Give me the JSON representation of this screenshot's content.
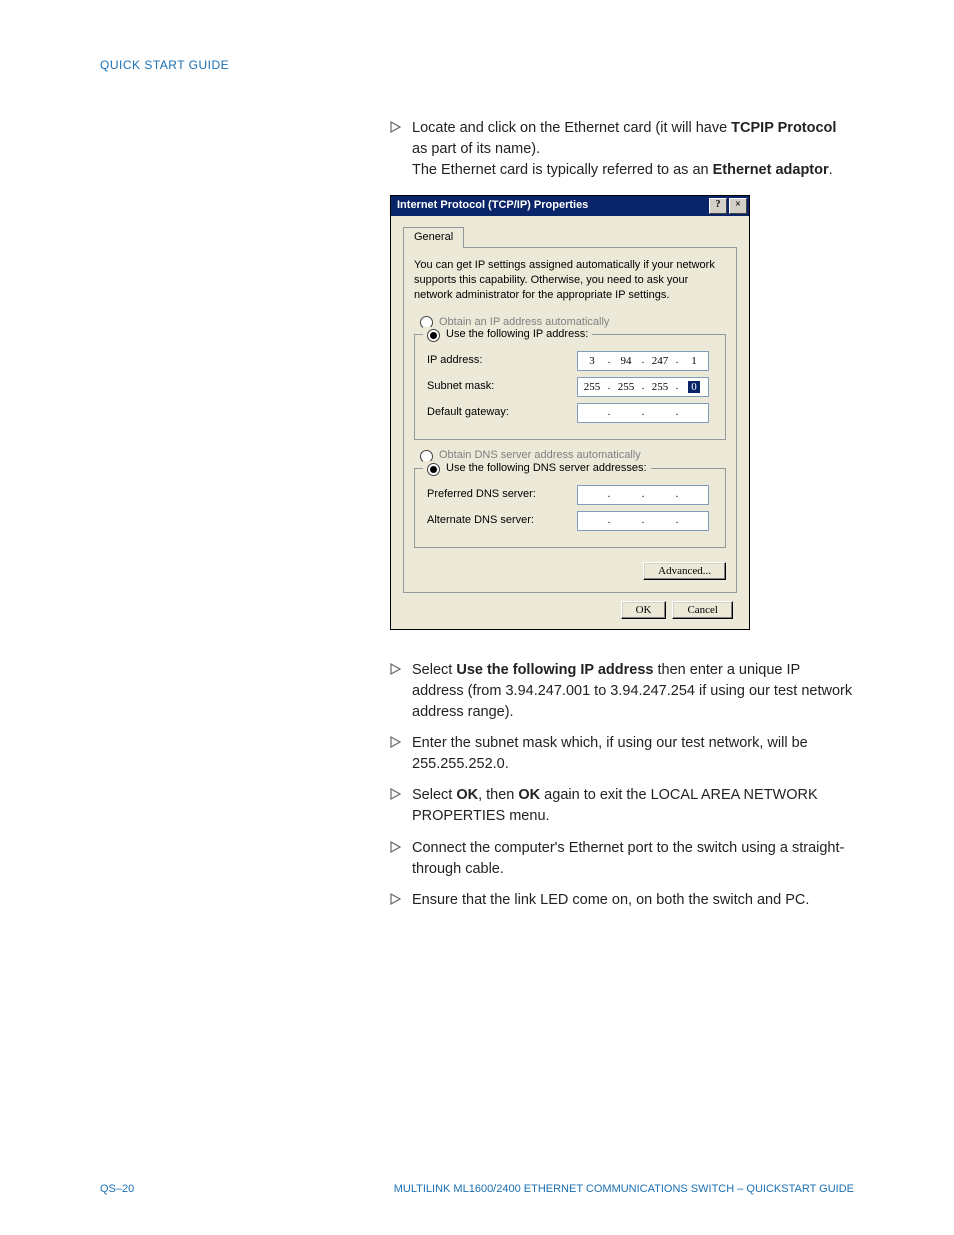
{
  "header": "QUICK START GUIDE",
  "steps_top": {
    "s1_a": "Locate and click on the Ethernet card (it will have ",
    "s1_b": "TCPIP Protocol",
    "s1_c": " as part of its name).",
    "s1_sub_a": "The Ethernet card is typically referred to as an ",
    "s1_sub_b": "Ethernet adaptor",
    "s1_sub_c": "."
  },
  "dialog": {
    "title": "Internet Protocol (TCP/IP) Properties",
    "help": "?",
    "close": "×",
    "tab": "General",
    "desc": "You can get IP settings assigned automatically if your network supports this capability. Otherwise, you need to ask your network administrator for the appropriate IP settings.",
    "r_auto_ip": "Obtain an IP address automatically",
    "r_use_ip": "Use the following IP address:",
    "lbl_ip": "IP address:",
    "lbl_mask": "Subnet mask:",
    "lbl_gw": "Default gateway:",
    "ip": {
      "a": "3",
      "b": "94",
      "c": "247",
      "d": "1"
    },
    "mask": {
      "a": "255",
      "b": "255",
      "c": "255",
      "d": "0"
    },
    "r_auto_dns": "Obtain DNS server address automatically",
    "r_use_dns": "Use the following DNS server addresses:",
    "lbl_pdns": "Preferred DNS server:",
    "lbl_adns": "Alternate DNS server:",
    "advanced": "Advanced...",
    "ok": "OK",
    "cancel": "Cancel"
  },
  "steps_bottom": {
    "s2_a": "Select ",
    "s2_b": "Use the following IP address",
    "s2_c": " then enter a unique IP address (from 3.94.247.001 to 3.94.247.254 if using our test network address range).",
    "s3": "Enter the subnet mask which, if using our test network, will be 255.255.252.0.",
    "s4_a": "Select ",
    "s4_b": "OK",
    "s4_c": ", then ",
    "s4_d": "OK",
    "s4_e": " again to exit the LOCAL AREA NETWORK PROPERTIES menu.",
    "s5": "Connect the computer's Ethernet port to the switch using a straight-through cable.",
    "s6": "Ensure that the link LED come on, on both the switch and PC."
  },
  "footer": {
    "left": "QS–20",
    "right": "MULTILINK ML1600/2400 ETHERNET COMMUNICATIONS SWITCH – QUICKSTART GUIDE"
  }
}
